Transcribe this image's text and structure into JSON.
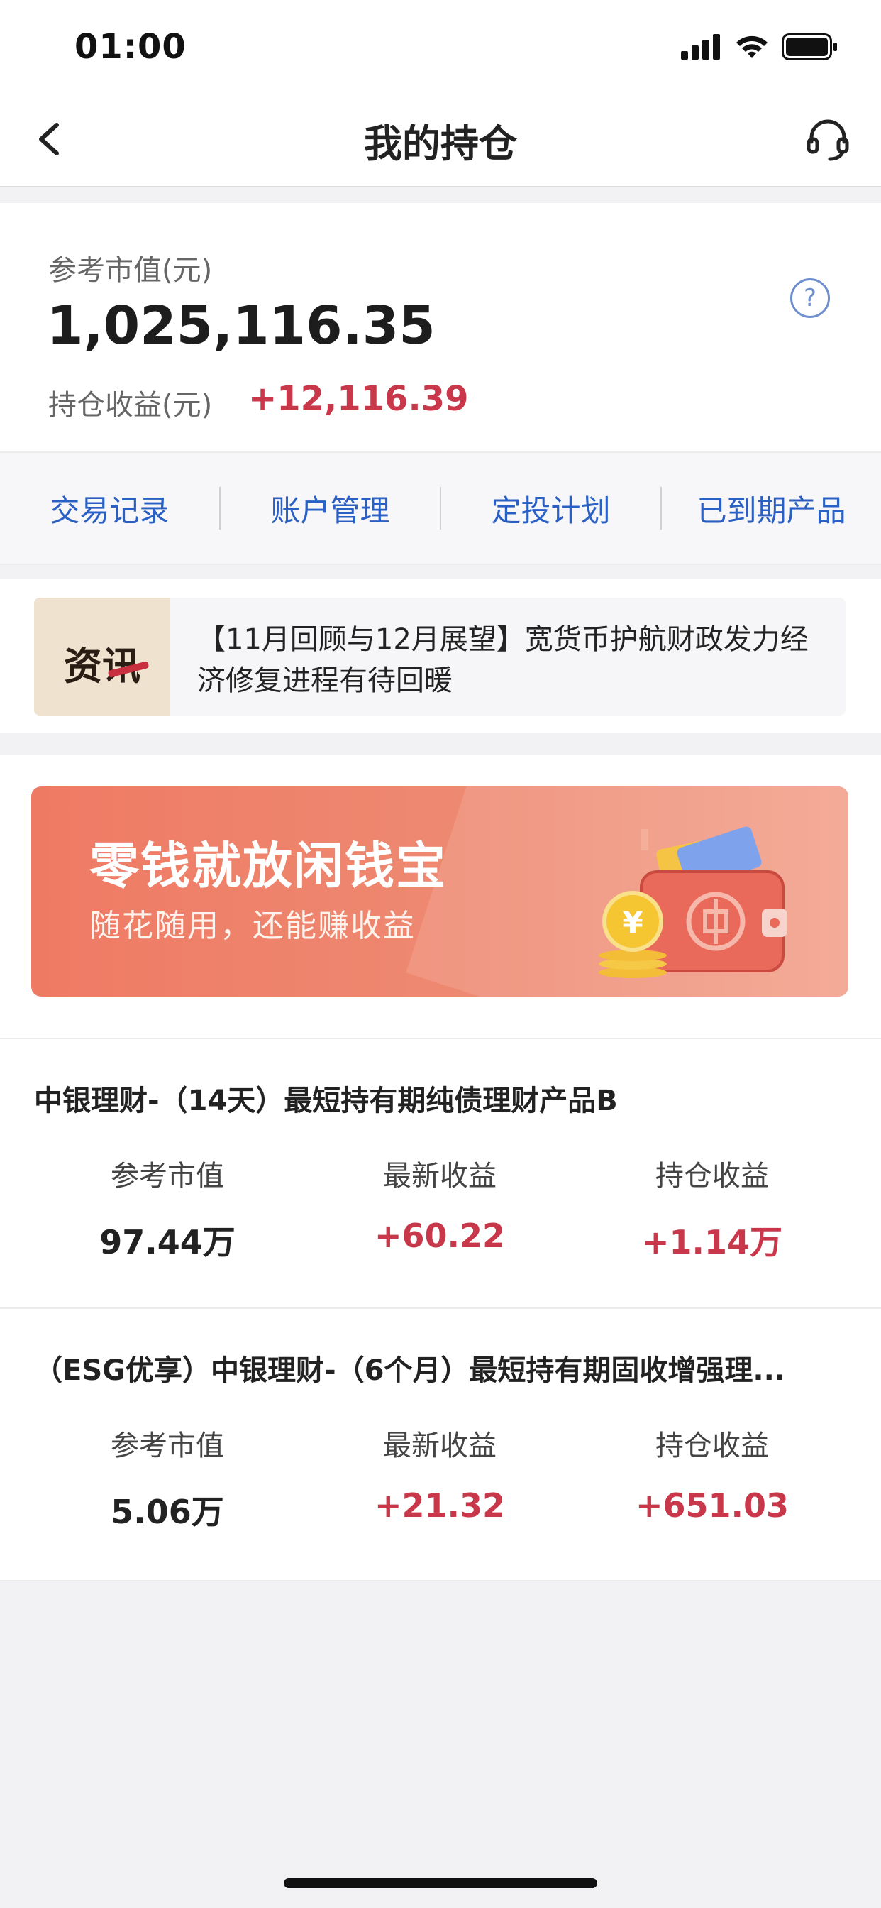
{
  "status_bar": {
    "time": "01:00"
  },
  "nav": {
    "title": "我的持仓"
  },
  "summary": {
    "market_value_label": "参考市值(元)",
    "market_value": "1,025,116.35",
    "profit_label": "持仓收益(元)",
    "profit_value": "+12,116.39",
    "help_glyph": "?"
  },
  "quick_links": [
    {
      "label": "交易记录"
    },
    {
      "label": "账户管理"
    },
    {
      "label": "定投计划"
    },
    {
      "label": "已到期产品"
    }
  ],
  "news": {
    "badge": "资讯",
    "text": "【11月回顾与12月展望】宽货币护航财政发力经济修复进程有待回暖"
  },
  "banner": {
    "title": "零钱就放闲钱宝",
    "subtitle": "随花随用，还能赚收益",
    "coin_glyph": "¥"
  },
  "products": [
    {
      "name": "中银理财-（14天）最短持有期纯债理财产品B",
      "metrics": [
        {
          "label": "参考市值",
          "value": "97.44万"
        },
        {
          "label": "最新收益",
          "value": "+60.22"
        },
        {
          "label": "持仓收益",
          "value": "+1.14万"
        }
      ]
    },
    {
      "name": "（ESG优享）中银理财-（6个月）最短持有期固收增强理...",
      "metrics": [
        {
          "label": "参考市值",
          "value": "5.06万"
        },
        {
          "label": "最新收益",
          "value": "+21.32"
        },
        {
          "label": "持仓收益",
          "value": "+651.03"
        }
      ]
    }
  ],
  "colors": {
    "accent_blue": "#2a60c4",
    "profit_red": "#c8384a",
    "banner_orange": "#ef7a64"
  }
}
